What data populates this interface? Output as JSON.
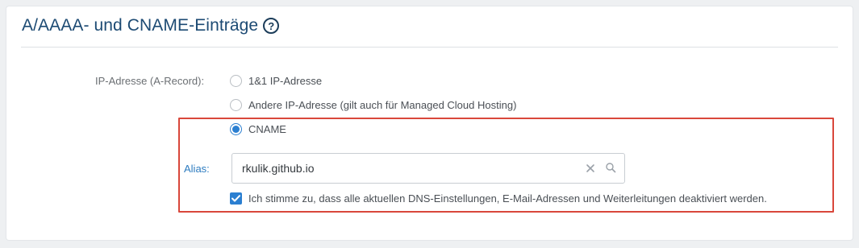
{
  "section": {
    "title": "A/AAAA- und CNAME-Einträge",
    "help_icon_glyph": "?"
  },
  "ip_field": {
    "label": "IP-Adresse (A-Record):",
    "options": [
      {
        "label": "1&1 IP-Adresse",
        "selected": false
      },
      {
        "label": "Andere IP-Adresse (gilt auch für Managed Cloud Hosting)",
        "selected": false
      },
      {
        "label": "CNAME",
        "selected": true
      }
    ]
  },
  "alias_field": {
    "label": "Alias:",
    "value": "rkulik.github.io",
    "clear_icon": "close-icon",
    "search_icon": "search-icon"
  },
  "consent": {
    "label": "Ich stimme zu, dass alle aktuellen DNS-Einstellungen, E-Mail-Adressen und Weiterleitungen deaktiviert werden.",
    "checked": true
  },
  "colors": {
    "accent": "#2b7fd1",
    "title": "#1c4a73",
    "highlight_border": "#d9473b"
  }
}
